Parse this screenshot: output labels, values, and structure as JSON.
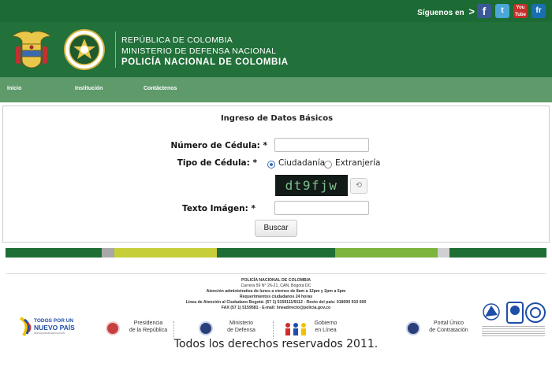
{
  "topbar": {
    "follow_text": "Síguenos en",
    "follow_arrow": ">",
    "social": [
      {
        "name": "facebook",
        "glyph": "f",
        "color": "#3b5998"
      },
      {
        "name": "twitter",
        "glyph": "t",
        "color": "#4aa7d8"
      },
      {
        "name": "youtube",
        "glyph": "You Tube",
        "color": "#c4302b"
      },
      {
        "name": "flickr",
        "glyph": "fr",
        "color": "#1a6fb2"
      }
    ]
  },
  "header": {
    "line1": "REPÚBLICA DE COLOMBIA",
    "line2": "MINISTERIO DE DEFENSA NACIONAL",
    "line3": "POLICÍA NACIONAL DE COLOMBIA",
    "bg_color": "#22703a"
  },
  "nav": {
    "items": [
      "Inicio",
      "Institución",
      "Contáctenos"
    ],
    "bg_color": "#5f9a6a"
  },
  "form": {
    "title": "Ingreso de Datos Básicos",
    "cedula_label": "Número de Cédula: *",
    "cedula_value": "",
    "tipo_label": "Tipo de Cédula: *",
    "tipo_options": [
      "Ciudadanía",
      "Extranjería"
    ],
    "tipo_selected": "Ciudadanía",
    "captcha_text": "dt9fjw",
    "texto_label": "Texto Imágen: *",
    "texto_value": "",
    "submit_label": "Buscar"
  },
  "stripe_colors": [
    "#1f6e35",
    "#a8a8a8",
    "#c6cf3a",
    "#1f6e35",
    "#7db43e",
    "#d0d0d0",
    "#1f6e35"
  ],
  "footer": {
    "org": "POLICÍA NACIONAL DE COLOMBIA",
    "address": "Carrera 59 N° 26-21, CAN, Bogotá DC",
    "hours": "Atención administrativa de lunes a viernes de 8am a 12pm y 2pm a 5pm",
    "requests": "Requerimientos ciudadanos 24 horas",
    "phone_line": "Línea de Atención al Ciudadano Bogotá: (57 1) 5159111/9112 - Resto del país: 018000 910 600",
    "fax_line": "FAX (57 1) 5159581 - E-mail: lineadirecto@policia.gov.co",
    "gov_logo_line1": "TODOS POR UN",
    "gov_logo_line2": "NUEVO PAÍS",
    "gov_logo_line3": "PAZ EQUIDAD EDUCACIÓN",
    "links": [
      {
        "line1": "Presidencia",
        "line2": "de la República"
      },
      {
        "line1": "Ministerio",
        "line2": "de Defensa"
      },
      {
        "line1": "Gobierno",
        "line2": "en Línea"
      },
      {
        "line1": "Portal Único",
        "line2": "de Contratación"
      }
    ]
  },
  "copyright": "Todos los derechos reservados 2011."
}
